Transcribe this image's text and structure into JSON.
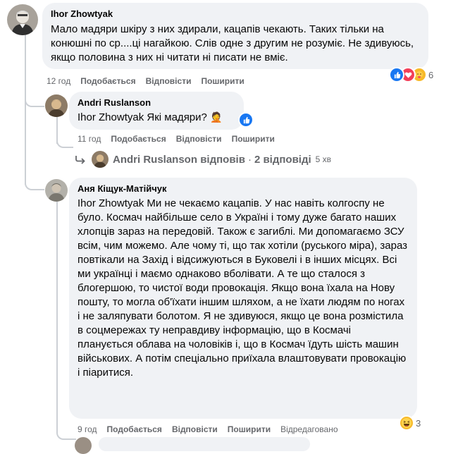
{
  "comments": [
    {
      "author": "Ihor Zhowtyak",
      "text": "Мало мадяри шкіру з них здирали, кацапів чекають. Таких тільки на конюшні по ср....ці нагайкою. Слів одне з другим не розуміє. Не здивуюсь, якщо половина з них ні читати ні писати не вміє.",
      "time": "12 год",
      "like": "Подобається",
      "reply": "Відповісти",
      "share": "Поширити",
      "reaction_count": "6",
      "reaction_icons": [
        "like-icon",
        "love-icon",
        "care-icon"
      ]
    },
    {
      "author": "Andri Ruslanson",
      "mention": "Ihor Zhowtyak",
      "text": " Які мадяри?",
      "emoji": "🤦",
      "time": "11 год",
      "like": "Подобається",
      "reply": "Відповісти",
      "share": "Поширити",
      "reaction_icons": [
        "like-icon"
      ]
    },
    {
      "author": "Аня Кіщук-Матійчук",
      "mention": "Ihor Zhowtyak",
      "text": " Ми не чекаємо кацапів. У нас навіть колгоспу не було. Космач найбільше село в Україні і тому дуже багато наших хлопців зараз на передовій. Також є загиблі. Ми допомагаємо ЗСУ всім, чим можемо. Але чому ті, що так хотіли (руського міра), зараз повтікали на Захід і відсижуються в Буковелі і в інших місцях. Всі ми українці і маємо однаково вболівати. А те що сталося з блогершою, то чистої води провокація. Якщо вона їхала на Нову пошту, то могла об'їхати іншим шляхом, а не їхати людям по ногах і не заляпувати болотом. Я не здивуюся, якщо це вона розмістила в соцмережах ту неправдиву інформацію, що в Космачі планується облава на чоловіків і, що в Космач їдуть шість машин військових. А потім спеціально приїхала влаштовувати провокацію і піаритися.",
      "time": "9 год",
      "like": "Подобається",
      "reply": "Відповісти",
      "share": "Поширити",
      "edited": "Відредаговано",
      "reaction_count": "3",
      "reaction_icons": [
        "haha-icon"
      ]
    }
  ],
  "replies_summary": {
    "author": "Andri Ruslanson",
    "verb": "відповів",
    "separator": "·",
    "count": "2 відповіді",
    "age": "5 хв"
  },
  "colors": {
    "bubble": "#f0f2f5",
    "meta": "#65676b",
    "like_blue": "#1877f2",
    "love_red": "#f33e58",
    "haha_yellow": "#f7b928"
  }
}
